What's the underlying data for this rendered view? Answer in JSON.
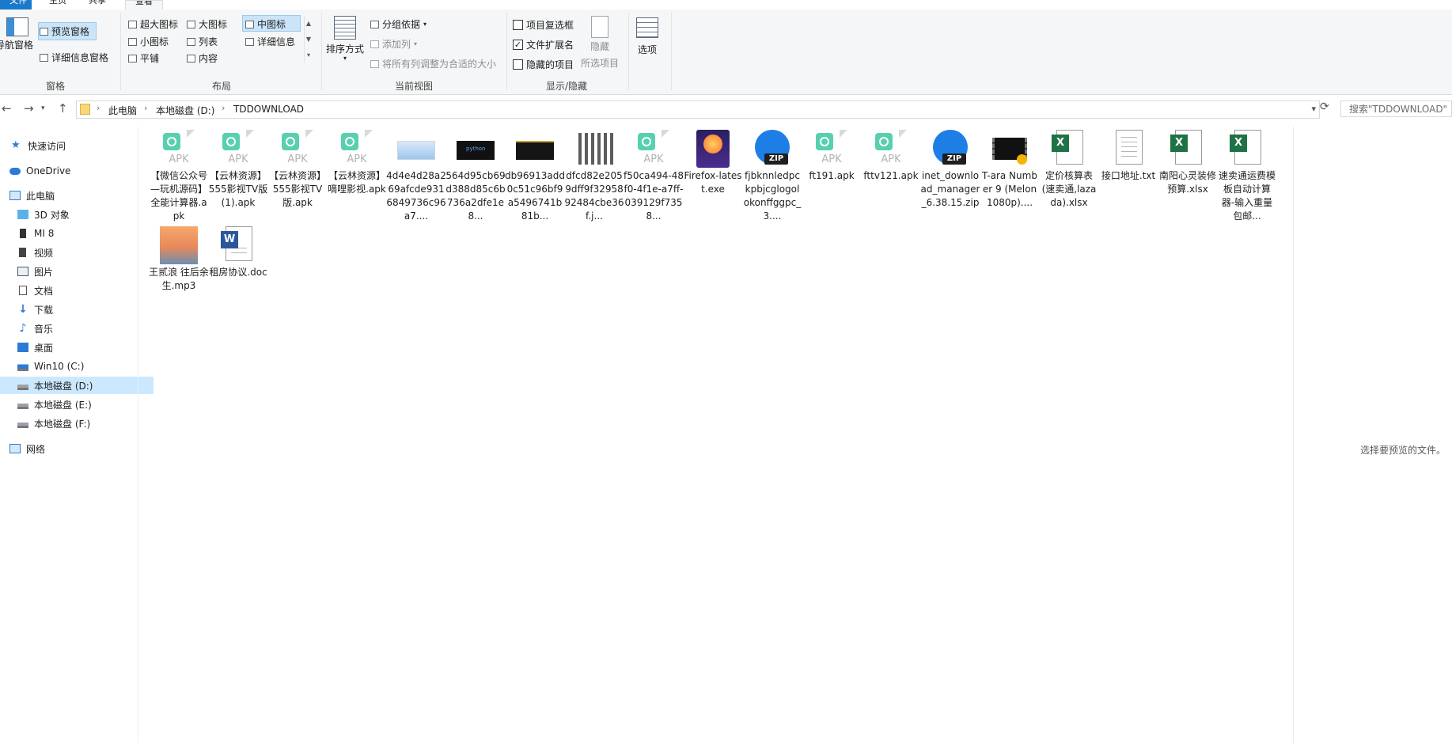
{
  "tabs": {
    "file": "文件",
    "home": "主页",
    "share": "共享",
    "view": "查看"
  },
  "ribbon": {
    "panes": {
      "nav_pane": "导航窗格",
      "preview_pane": "预览窗格",
      "details_pane": "详细信息窗格",
      "group_label": "窗格"
    },
    "layout": {
      "extra_large": "超大图标",
      "large": "大图标",
      "medium": "中图标",
      "small": "小图标",
      "list": "列表",
      "details": "详细信息",
      "tiles": "平铺",
      "content": "内容",
      "group_label": "布局",
      "selected": "中图标"
    },
    "current_view": {
      "sort_by": "排序方式",
      "group_by": "分组依据",
      "add_columns": "添加列",
      "size_all_columns": "将所有列调整为合适的大小",
      "group_label": "当前视图"
    },
    "show_hide": {
      "item_checkboxes": "项目复选框",
      "item_checkboxes_checked": false,
      "file_extensions": "文件扩展名",
      "file_extensions_checked": true,
      "hidden_items": "隐藏的项目",
      "hidden_items_checked": false,
      "hide_selected": "隐藏",
      "hide_selected_sub": "所选项目",
      "group_label": "显示/隐藏"
    },
    "options": "选项"
  },
  "address": {
    "crumbs": [
      "此电脑",
      "本地磁盘 (D:)",
      "TDDOWNLOAD"
    ],
    "search_placeholder": "搜索\"TDDOWNLOAD\""
  },
  "nav": {
    "quick_access": "快速访问",
    "onedrive": "OneDrive",
    "this_pc": "此电脑",
    "items": [
      "3D 对象",
      "MI 8",
      "视频",
      "图片",
      "文档",
      "下载",
      "音乐",
      "桌面",
      "Win10 (C:)",
      "本地磁盘 (D:)",
      "本地磁盘 (E:)",
      "本地磁盘 (F:)"
    ],
    "selected": "本地磁盘 (D:)",
    "network": "网络"
  },
  "files": [
    {
      "name": "【微信公众号—玩机源码】全能计算器.apk",
      "icon": "apk-icon",
      "label": "APK"
    },
    {
      "name": "【云林资源】555影视TV版(1).apk",
      "icon": "apk-icon",
      "label": "APK"
    },
    {
      "name": "【云林资源】555影视TV版.apk",
      "icon": "apk-icon",
      "label": "APK"
    },
    {
      "name": "【云林资源】嘀哩影视.apk",
      "icon": "apk-icon",
      "label": "APK"
    },
    {
      "name": "4d4e4d28a269afcde9316849736c96a7....",
      "icon": "image-thumbnail-icon"
    },
    {
      "name": "564d95cb69d388d85c6b736a2dfe1e8...",
      "icon": "image-thumbnail-icon"
    },
    {
      "name": "db96913add0c51c96bf9a5496741b81b...",
      "icon": "image-thumbnail-icon"
    },
    {
      "name": "dfcd82e2059dff9f3295892484cbe36f.j...",
      "icon": "image-thumbnail-icon"
    },
    {
      "name": "f50ca494-48f0-4f1e-a7ff-039129f7358...",
      "icon": "apk-icon",
      "label": "APK"
    },
    {
      "name": "Firefox-latest.exe",
      "icon": "firefox-installer-icon"
    },
    {
      "name": "fjbknnledpckpbjcglogolokonffggpc_3....",
      "icon": "zip-icon",
      "label": "ZIP"
    },
    {
      "name": "ft191.apk",
      "icon": "apk-icon",
      "label": "APK"
    },
    {
      "name": "fttv121.apk",
      "icon": "apk-icon",
      "label": "APK"
    },
    {
      "name": "inet_download_manager_6.38.15.zip",
      "icon": "zip-icon",
      "label": "ZIP"
    },
    {
      "name": "T-ara Number 9 (Melon 1080p)....",
      "icon": "video-icon"
    },
    {
      "name": "定价核算表(速卖通,lazada).xlsx",
      "icon": "excel-icon",
      "label": "X"
    },
    {
      "name": "接口地址.txt",
      "icon": "text-file-icon"
    },
    {
      "name": "南阳心灵装修预算.xlsx",
      "icon": "excel-icon",
      "label": "X"
    },
    {
      "name": "速卖通运费模板自动计算器-输入重量包邮...",
      "icon": "excel-icon",
      "label": "X"
    },
    {
      "name": "王贰浪 往后余生.mp3",
      "icon": "audio-thumbnail-icon"
    },
    {
      "name": "租房协议.doc",
      "icon": "word-icon",
      "label": "W"
    }
  ],
  "preview": {
    "empty_text": "选择要预览的文件。"
  },
  "colors": {
    "accent": "#1979ca",
    "selection": "#cce8ff",
    "apk_badge": "#58d0b0",
    "zip_blue": "#1d7fe5"
  }
}
